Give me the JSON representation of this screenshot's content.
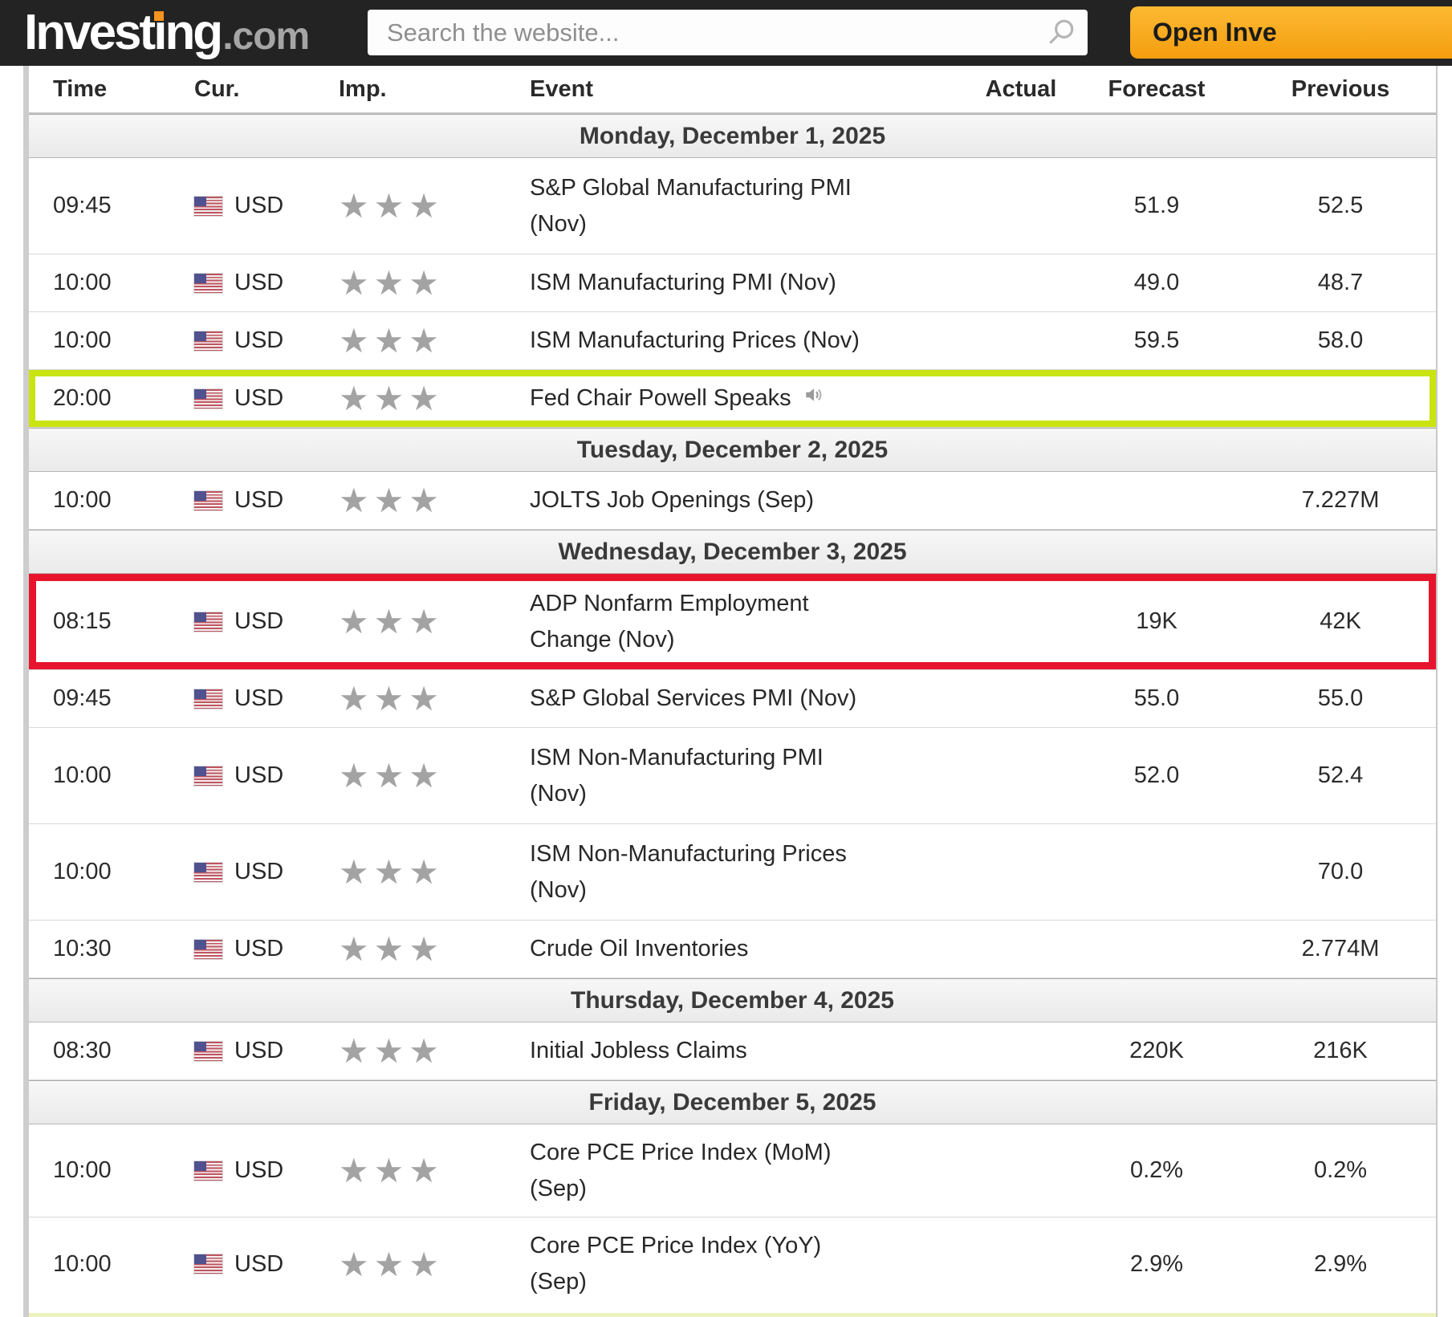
{
  "header": {
    "logo": {
      "pre": "Invest",
      "i": "ı",
      "post": "ng",
      "suffix": ".com",
      "text": "Investing.com"
    },
    "search": {
      "placeholder": "Search the website...",
      "icon": "search-icon"
    },
    "open_button_label": "Open Inve",
    "colors": {
      "bar_background": "#232323",
      "button_orange": "#f7a51f",
      "logo_dot_orange": "#f7941d"
    }
  },
  "icons": {
    "importance_stars": "★★★",
    "importance_icon": "star-icon",
    "audio_icon": "speaker-icon",
    "flag_icon": "us-flag-icon"
  },
  "colors": {
    "highlight_yellow": "#c9e411",
    "highlight_red": "#e8142e",
    "star_gray": "#a3a3a3"
  },
  "table": {
    "columns": {
      "time": "Time",
      "cur": "Cur.",
      "imp": "Imp.",
      "event": "Event",
      "actual": "Actual",
      "forecast": "Forecast",
      "previous": "Previous"
    },
    "rows": [
      {
        "type": "date",
        "label": "Monday, December 1, 2025"
      },
      {
        "type": "event",
        "time": "09:45",
        "currency": "USD",
        "importance": 3,
        "event_line1": "S&P Global Manufacturing PMI",
        "event_line2": "(Nov)",
        "actual": "",
        "forecast": "51.9",
        "previous": "52.5"
      },
      {
        "type": "event",
        "time": "10:00",
        "currency": "USD",
        "importance": 3,
        "event_line1": "ISM Manufacturing PMI (Nov)",
        "event_line2": "",
        "actual": "",
        "forecast": "49.0",
        "previous": "48.7"
      },
      {
        "type": "event",
        "time": "10:00",
        "currency": "USD",
        "importance": 3,
        "event_line1": "ISM Manufacturing Prices (Nov)",
        "event_line2": "",
        "actual": "",
        "forecast": "59.5",
        "previous": "58.0"
      },
      {
        "type": "event",
        "time": "20:00",
        "currency": "USD",
        "importance": 3,
        "event_line1": "Fed Chair Powell Speaks",
        "event_line2": "",
        "actual": "",
        "forecast": "",
        "previous": "",
        "highlight": "yellow",
        "has_audio_icon": true
      },
      {
        "type": "date",
        "label": "Tuesday, December 2, 2025"
      },
      {
        "type": "event",
        "time": "10:00",
        "currency": "USD",
        "importance": 3,
        "event_line1": "JOLTS Job Openings (Sep)",
        "event_line2": "",
        "actual": "",
        "forecast": "",
        "previous": "7.227M"
      },
      {
        "type": "date",
        "label": "Wednesday, December 3, 2025"
      },
      {
        "type": "event",
        "time": "08:15",
        "currency": "USD",
        "importance": 3,
        "event_line1": "ADP Nonfarm Employment",
        "event_line2": "Change (Nov)",
        "actual": "",
        "forecast": "19K",
        "previous": "42K",
        "highlight": "red"
      },
      {
        "type": "event",
        "time": "09:45",
        "currency": "USD",
        "importance": 3,
        "event_line1": "S&P Global Services PMI (Nov)",
        "event_line2": "",
        "actual": "",
        "forecast": "55.0",
        "previous": "55.0"
      },
      {
        "type": "event",
        "time": "10:00",
        "currency": "USD",
        "importance": 3,
        "event_line1": "ISM Non-Manufacturing PMI",
        "event_line2": "(Nov)",
        "actual": "",
        "forecast": "52.0",
        "previous": "52.4"
      },
      {
        "type": "event",
        "time": "10:00",
        "currency": "USD",
        "importance": 3,
        "event_line1": "ISM Non-Manufacturing Prices",
        "event_line2": "(Nov)",
        "actual": "",
        "forecast": "",
        "previous": "70.0"
      },
      {
        "type": "event",
        "time": "10:30",
        "currency": "USD",
        "importance": 3,
        "event_line1": "Crude Oil Inventories",
        "event_line2": "",
        "actual": "",
        "forecast": "",
        "previous": "2.774M"
      },
      {
        "type": "date",
        "label": "Thursday, December 4, 2025"
      },
      {
        "type": "event",
        "time": "08:30",
        "currency": "USD",
        "importance": 3,
        "event_line1": "Initial Jobless Claims",
        "event_line2": "",
        "actual": "",
        "forecast": "220K",
        "previous": "216K"
      },
      {
        "type": "date",
        "label": "Friday, December 5, 2025"
      },
      {
        "type": "event",
        "time": "10:00",
        "currency": "USD",
        "importance": 3,
        "event_line1": "Core PCE Price Index (MoM)",
        "event_line2": "(Sep)",
        "actual": "",
        "forecast": "0.2%",
        "previous": "0.2%",
        "highlight": "red-group"
      },
      {
        "type": "event",
        "time": "10:00",
        "currency": "USD",
        "importance": 3,
        "event_line1": "Core PCE Price Index (YoY)",
        "event_line2": "(Sep)",
        "actual": "",
        "forecast": "2.9%",
        "previous": "2.9%",
        "highlight": "red-group"
      }
    ]
  }
}
